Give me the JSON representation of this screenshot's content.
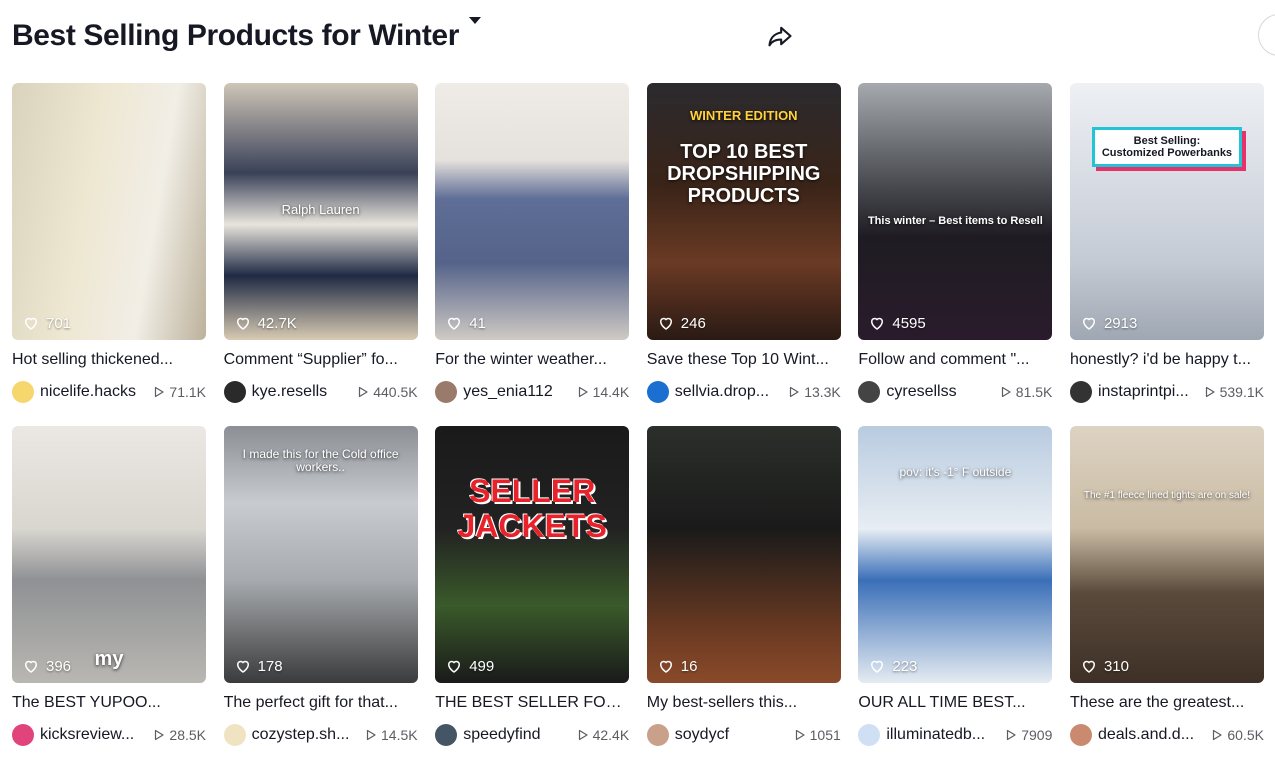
{
  "header": {
    "title": "Best Selling Products for Winter"
  },
  "cards": [
    {
      "desc": "Hot selling thickened...",
      "likes": "701",
      "user": "nicelife.hacks",
      "views": "71.1K",
      "overlay": "",
      "bg": "linear-gradient(100deg,#d9d3bd 0%,#eee7d2 40%,#f1eee6 70%,#bcb19b 100%)",
      "avatar": "#f5d76e"
    },
    {
      "desc": "Comment “Supplier” fo...",
      "likes": "42.7K",
      "user": "kye.resells",
      "views": "440.5K",
      "overlay": "Ralph Lauren",
      "bg": "linear-gradient(180deg,#cfc6b8 0%,#3a4158 35%,#e8e4dc 55%,#1f2a44 75%,#d9cbb3 100%)",
      "avatar": "#2a2a2a"
    },
    {
      "desc": "For the winter weather...",
      "likes": "41",
      "user": "yes_enia112",
      "views": "14.4K",
      "overlay": "",
      "bg": "linear-gradient(180deg,#efece8 0%,#e5e1dc 30%,#5f6e96 45%,#55638a 70%,#cfcac4 100%)",
      "avatar": "#9a7a6a"
    },
    {
      "desc": "Save these Top 10 Wint...",
      "likes": "246",
      "user": "sellvia.drop...",
      "views": "13.3K",
      "overlay": "TOP 10 BEST DROPSHIPPING PRODUCTS",
      "sub": "WINTER EDITION",
      "bg": "linear-gradient(180deg,#2b2a2e 0%,#3a2418 40%,#6a3a24 70%,#2a1a14 100%)",
      "avatar": "#1a6fd1"
    },
    {
      "desc": "Follow and comment \"...",
      "likes": "4595",
      "user": "cyresellss",
      "views": "81.5K",
      "overlay": "This winter – Best items to Resell",
      "bg": "linear-gradient(180deg,#a6a9ad 0%,#5e6166 30%,#1e1c22 60%,#2a1b2c 100%)",
      "avatar": "#444"
    },
    {
      "desc": "honestly? i'd be happy t...",
      "likes": "2913",
      "user": "instaprintpi...",
      "views": "539.1K",
      "overlay": "Best Selling: Customized Powerbanks",
      "bg": "linear-gradient(180deg,#eef0f4 0%,#d6dbe3 40%,#c4cad4 70%,#9fa7b2 100%)",
      "avatar": "#333"
    },
    {
      "desc": "The BEST YUPOO...",
      "likes": "396",
      "user": "kicksreview...",
      "views": "28.5K",
      "overlay": "my",
      "bg": "linear-gradient(180deg,#ebe8e3 0%,#d9d6d0 40%,#8f9194 60%,#b9b7b2 100%)",
      "avatar": "#e0447a"
    },
    {
      "desc": "The perfect gift for that...",
      "likes": "178",
      "user": "cozystep.sh...",
      "views": "14.5K",
      "overlay": "I made this for the Cold office workers..",
      "bg": "linear-gradient(180deg,#8b8f94 0%,#c8cbcf 30%,#a7aaae 60%,#3a3b3c 100%)",
      "avatar": "#f0e3c2"
    },
    {
      "desc": "THE BEST SELLER FOR...",
      "likes": "499",
      "user": "speedyfind",
      "views": "42.4K",
      "overlay": "SELLER JACKETS",
      "bg": "linear-gradient(180deg,#1a1a1a 0%,#222 40%,#3a5a2a 70%,#1a1a1a 100%)",
      "avatar": "#445566"
    },
    {
      "desc": "My best-sellers this...",
      "likes": "16",
      "user": "soydycf",
      "views": "1051",
      "overlay": "",
      "bg": "linear-gradient(180deg,#2b2f2a 0%,#1a1a1a 40%,#6b3a22 80%,#8a4a2a 100%)",
      "avatar": "#c9a08a"
    },
    {
      "desc": "OUR ALL TIME BEST...",
      "likes": "223",
      "user": "illuminatedb...",
      "views": "7909",
      "overlay": "pov: it's -1° F outside",
      "bg": "linear-gradient(180deg,#b9cbe0 0%,#e7edf3 40%,#3a6fb8 60%,#e5ebf1 100%)",
      "avatar": "#cfe0f5"
    },
    {
      "desc": "These are the greatest...",
      "likes": "310",
      "user": "deals.and.d...",
      "views": "60.5K",
      "overlay": "The #1 fleece lined tights are on sale!",
      "bg": "linear-gradient(180deg,#ddd3c3 0%,#c9bba3 40%,#5a4a3c 65%,#3e3026 100%)",
      "avatar": "#c98a70"
    }
  ]
}
